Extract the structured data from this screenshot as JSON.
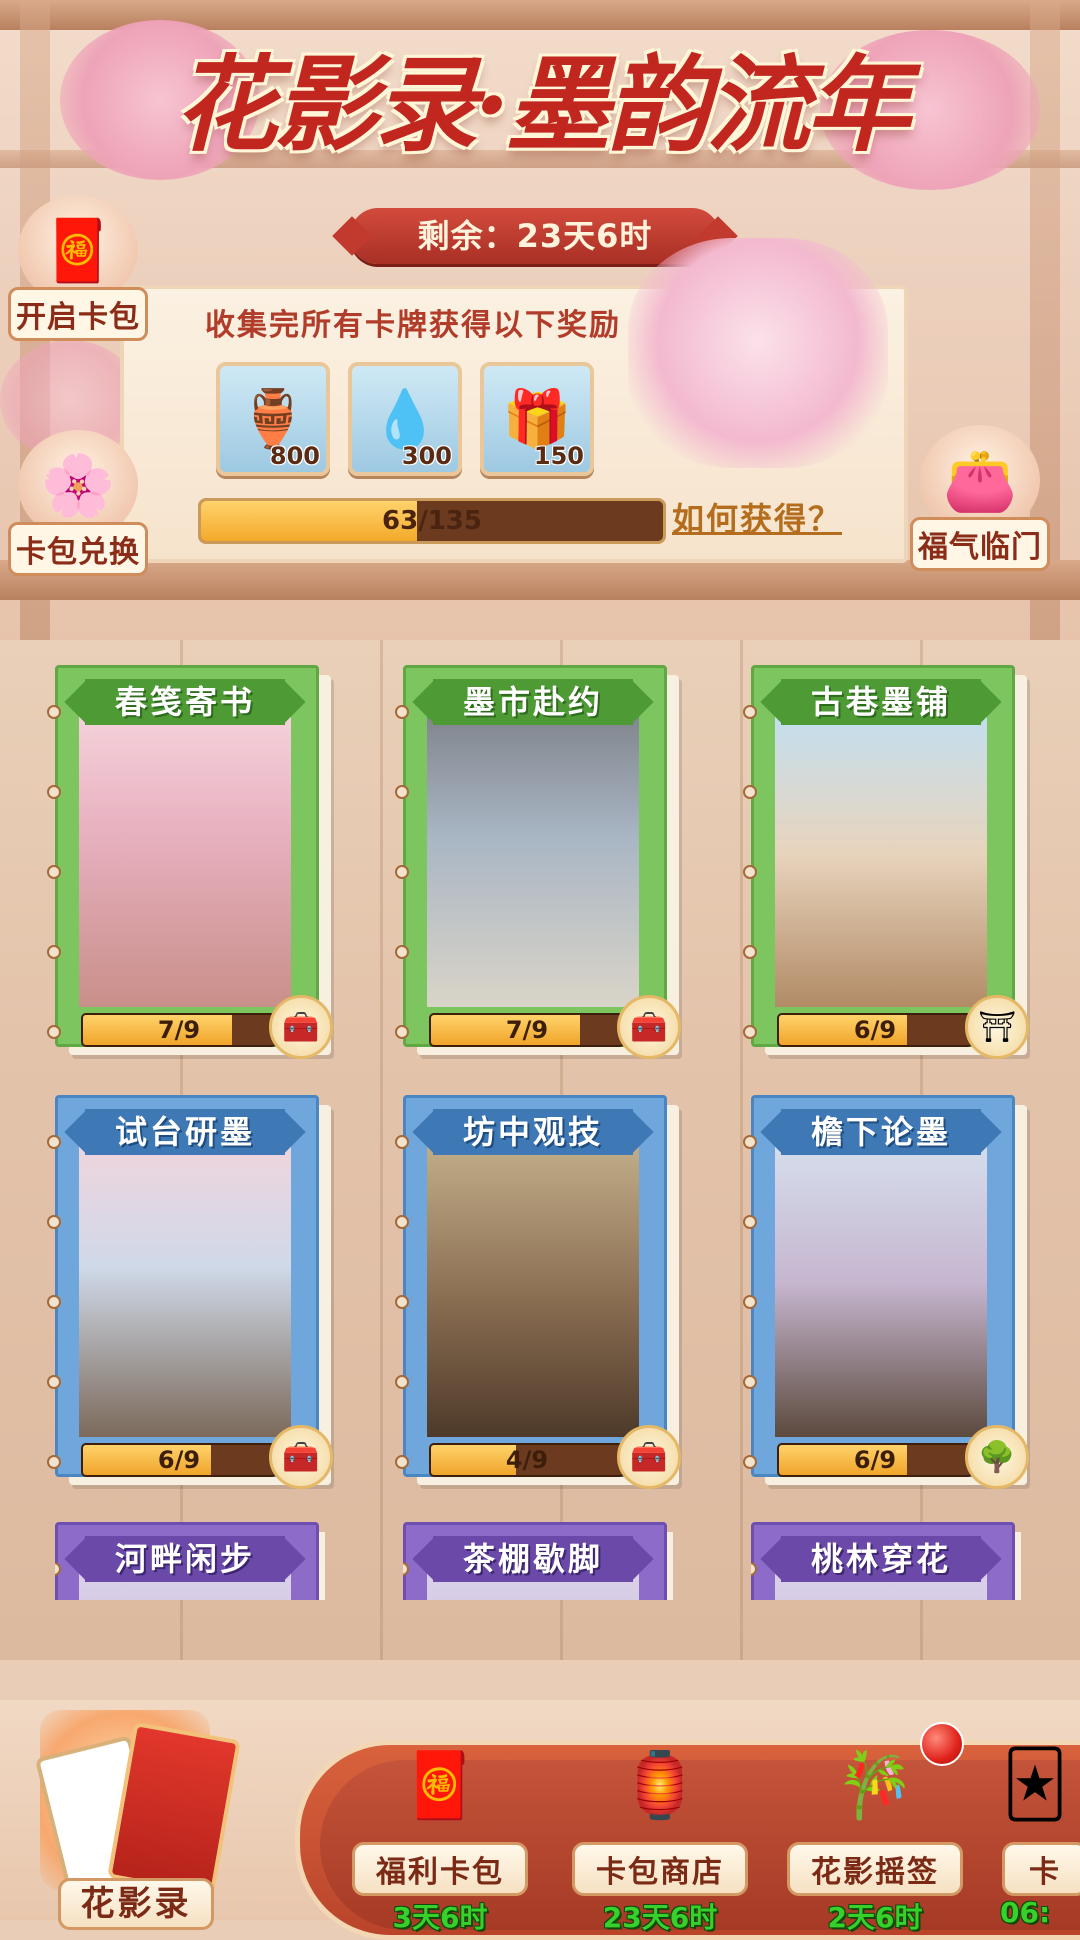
{
  "header": {
    "title": "花影录·墨韵流年",
    "timer": "剩余：23天6时"
  },
  "side_buttons": {
    "open_pack": "开启卡包",
    "exchange": "卡包兑换",
    "fortune": "福气临门"
  },
  "rewards": {
    "description": "收集完所有卡牌获得以下奖励",
    "items": [
      {
        "icon": "vase-icon",
        "qty": "800"
      },
      {
        "icon": "water-drop-icon",
        "qty": "300"
      },
      {
        "icon": "treasure-chest-icon",
        "qty": "150"
      }
    ],
    "progress_text": "63/135",
    "progress_fraction": 0.4667,
    "how_to_get": "如何获得？"
  },
  "cards": [
    {
      "name": "春笺寄书",
      "progress": "7/9",
      "fraction": 0.778,
      "color": "green",
      "badge": "chest-icon"
    },
    {
      "name": "墨市赴约",
      "progress": "7/9",
      "fraction": 0.778,
      "color": "green",
      "badge": "chest-icon"
    },
    {
      "name": "古巷墨铺",
      "progress": "6/9",
      "fraction": 0.667,
      "color": "green",
      "badge": "pavilion-icon"
    },
    {
      "name": "试台研墨",
      "progress": "6/9",
      "fraction": 0.667,
      "color": "blue",
      "badge": "chest-icon"
    },
    {
      "name": "坊中观技",
      "progress": "4/9",
      "fraction": 0.444,
      "color": "blue",
      "badge": "chest-icon"
    },
    {
      "name": "檐下论墨",
      "progress": "6/9",
      "fraction": 0.667,
      "color": "blue",
      "badge": "tree-icon"
    },
    {
      "name": "河畔闲步",
      "progress": "",
      "color": "purple"
    },
    {
      "name": "茶棚歇脚",
      "progress": "",
      "color": "purple"
    },
    {
      "name": "桃林穿花",
      "progress": "",
      "color": "purple"
    }
  ],
  "bottom_nav": {
    "main_tab": "花影录",
    "items": [
      {
        "label": "福利卡包",
        "time": "3天6时",
        "icon": "gift-pack-icon"
      },
      {
        "label": "卡包商店",
        "time": "23天6时",
        "icon": "shop-icon"
      },
      {
        "label": "花影摇签",
        "time": "2天6时",
        "icon": "fortune-stick-icon"
      },
      {
        "label": "卡",
        "time": "06:",
        "icon": "card-icon"
      }
    ]
  },
  "colors": {
    "accent_red": "#c1271e",
    "green_card": "#7dc55e",
    "blue_card": "#6fa6dc",
    "purple_card": "#8d6bc8",
    "timer_green": "#38d12b"
  }
}
